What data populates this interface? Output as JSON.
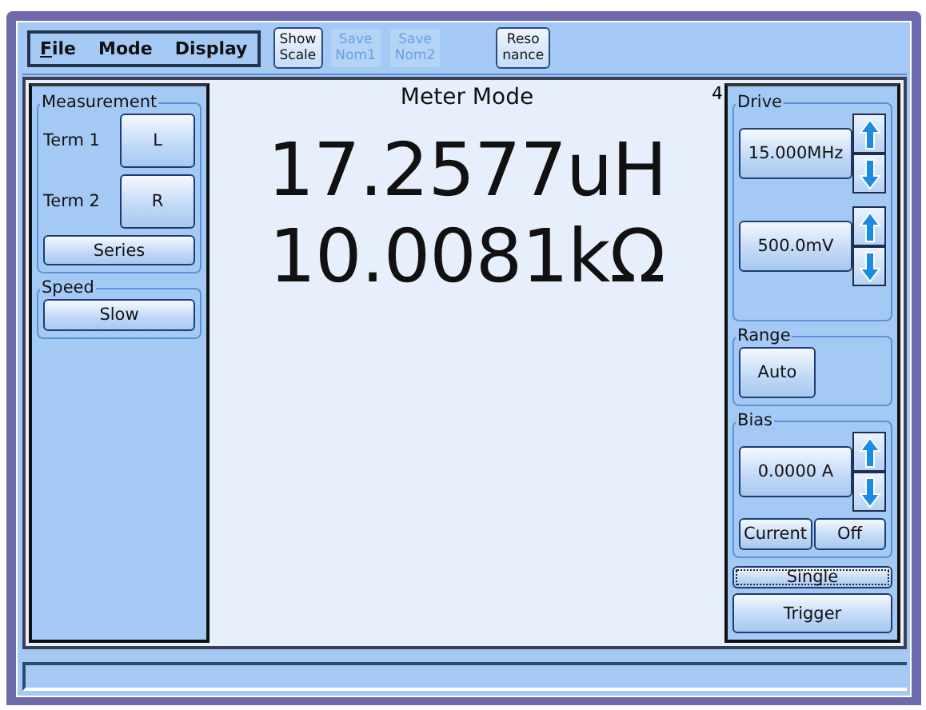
{
  "menu": [
    {
      "label": "File",
      "underline_first": true
    },
    {
      "label": "Mode",
      "underline_first": false
    },
    {
      "label": "Display",
      "underline_first": false
    }
  ],
  "toolbar": [
    {
      "lines": [
        "Show",
        "Scale"
      ],
      "disabled": false
    },
    {
      "lines": [
        "Save",
        "Nom1"
      ],
      "disabled": true
    },
    {
      "lines": [
        "Save",
        "Nom2"
      ],
      "disabled": true
    },
    {
      "lines": [
        "Reso",
        "nance"
      ],
      "disabled": false
    }
  ],
  "measurement": {
    "title": "Measurement",
    "terms": [
      {
        "label": "Term 1",
        "value": "L"
      },
      {
        "label": "Term 2",
        "value": "R"
      }
    ],
    "mode": "Series"
  },
  "speed": {
    "title": "Speed",
    "value": "Slow"
  },
  "meter": {
    "title": "Meter Mode",
    "corner": "4",
    "readings": [
      "17.2577uH",
      "10.0081kΩ"
    ]
  },
  "drive": {
    "title": "Drive",
    "values": [
      "15.000MHz",
      "500.0mV"
    ]
  },
  "range": {
    "title": "Range",
    "value": "Auto"
  },
  "bias": {
    "title": "Bias",
    "value": "0.0000 A",
    "type": "Current",
    "state": "Off"
  },
  "single": {
    "label": "Single",
    "focused": true
  },
  "trigger": {
    "label": "Trigger"
  }
}
